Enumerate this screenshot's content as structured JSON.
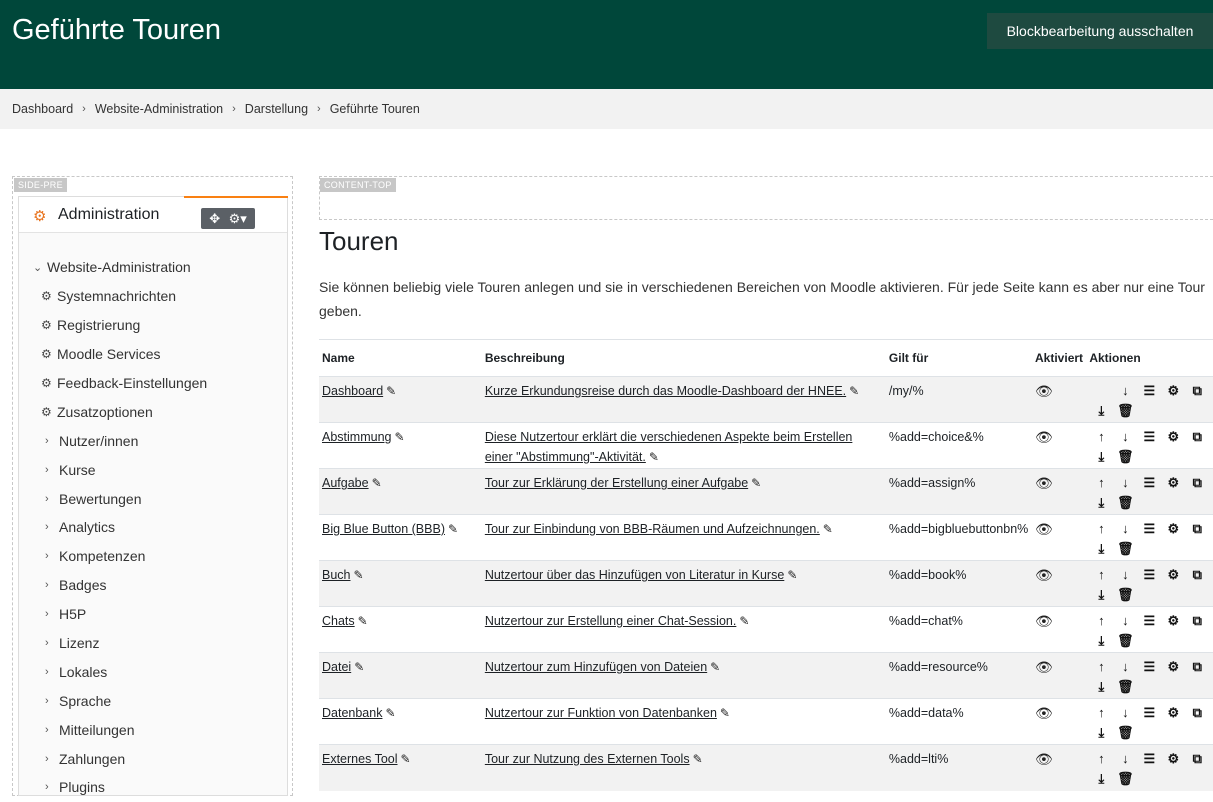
{
  "header": {
    "title": "Geführte Touren",
    "edit_button": "Blockbearbeitung ausschalten"
  },
  "breadcrumb": [
    "Dashboard",
    "Website-Administration",
    "Darstellung",
    "Geführte Touren"
  ],
  "regions": {
    "side": "SIDE-PRE",
    "content": "CONTENT-TOP"
  },
  "admin_block": {
    "title": "Administration",
    "root": "Website-Administration",
    "items": [
      {
        "label": "Systemnachrichten",
        "type": "leaf"
      },
      {
        "label": "Registrierung",
        "type": "leaf"
      },
      {
        "label": "Moodle Services",
        "type": "leaf"
      },
      {
        "label": "Feedback-Einstellungen",
        "type": "leaf"
      },
      {
        "label": "Zusatzoptionen",
        "type": "leaf"
      },
      {
        "label": "Nutzer/innen",
        "type": "branch"
      },
      {
        "label": "Kurse",
        "type": "branch"
      },
      {
        "label": "Bewertungen",
        "type": "branch"
      },
      {
        "label": "Analytics",
        "type": "branch"
      },
      {
        "label": "Kompetenzen",
        "type": "branch"
      },
      {
        "label": "Badges",
        "type": "branch"
      },
      {
        "label": "H5P",
        "type": "branch"
      },
      {
        "label": "Lizenz",
        "type": "branch"
      },
      {
        "label": "Lokales",
        "type": "branch"
      },
      {
        "label": "Sprache",
        "type": "branch"
      },
      {
        "label": "Mitteilungen",
        "type": "branch"
      },
      {
        "label": "Zahlungen",
        "type": "branch"
      },
      {
        "label": "Plugins",
        "type": "branch"
      }
    ]
  },
  "main": {
    "heading": "Touren",
    "intro": "Sie können beliebig viele Touren anlegen und sie in verschiedenen Bereichen von Moodle aktivieren. Für jede Seite kann es aber nur eine Tour geben.",
    "columns": [
      "Name",
      "Beschreibung",
      "Gilt für",
      "Aktiviert",
      "Aktionen"
    ],
    "tours": [
      {
        "name": "Dashboard",
        "description": "Kurze Erkundungsreise durch das Moodle-Dashboard der HNEE.",
        "path": "/my/%",
        "up": false
      },
      {
        "name": "Abstimmung",
        "description": "Diese Nutzertour erklärt die verschiedenen Aspekte beim Erstellen einer \"Abstimmung\"-Aktivität.",
        "path": "%add=choice&%",
        "up": true
      },
      {
        "name": "Aufgabe",
        "description": "Tour zur Erklärung der Erstellung einer Aufgabe",
        "path": "%add=assign%",
        "up": true
      },
      {
        "name": "Big Blue Button (BBB)",
        "description": "Tour zur Einbindung von BBB-Räumen und Aufzeichnungen.",
        "path": "%add=bigbluebuttonbn%",
        "up": true
      },
      {
        "name": "Buch",
        "description": "Nutzertour über das Hinzufügen von Literatur in Kurse",
        "path": "%add=book%",
        "up": true
      },
      {
        "name": "Chats",
        "description": "Nutzertour zur Erstellung einer Chat-Session.",
        "path": "%add=chat%",
        "up": true
      },
      {
        "name": "Datei",
        "description": "Nutzertour zum Hinzufügen von Dateien",
        "path": "%add=resource%",
        "up": true
      },
      {
        "name": "Datenbank",
        "description": "Nutzertour zur Funktion von Datenbanken",
        "path": "%add=data%",
        "up": true
      },
      {
        "name": "Externes Tool",
        "description": "Tour zur Nutzung des Externen Tools",
        "path": "%add=lti%",
        "up": true
      }
    ]
  },
  "icons": {
    "edit": "pencil-icon",
    "enabled": "eye-icon",
    "up": "arrow-up-icon",
    "down": "arrow-down-icon",
    "steps": "list-icon",
    "settings": "gear-icon",
    "duplicate": "copy-icon",
    "export": "download-icon",
    "delete": "trash-icon"
  }
}
